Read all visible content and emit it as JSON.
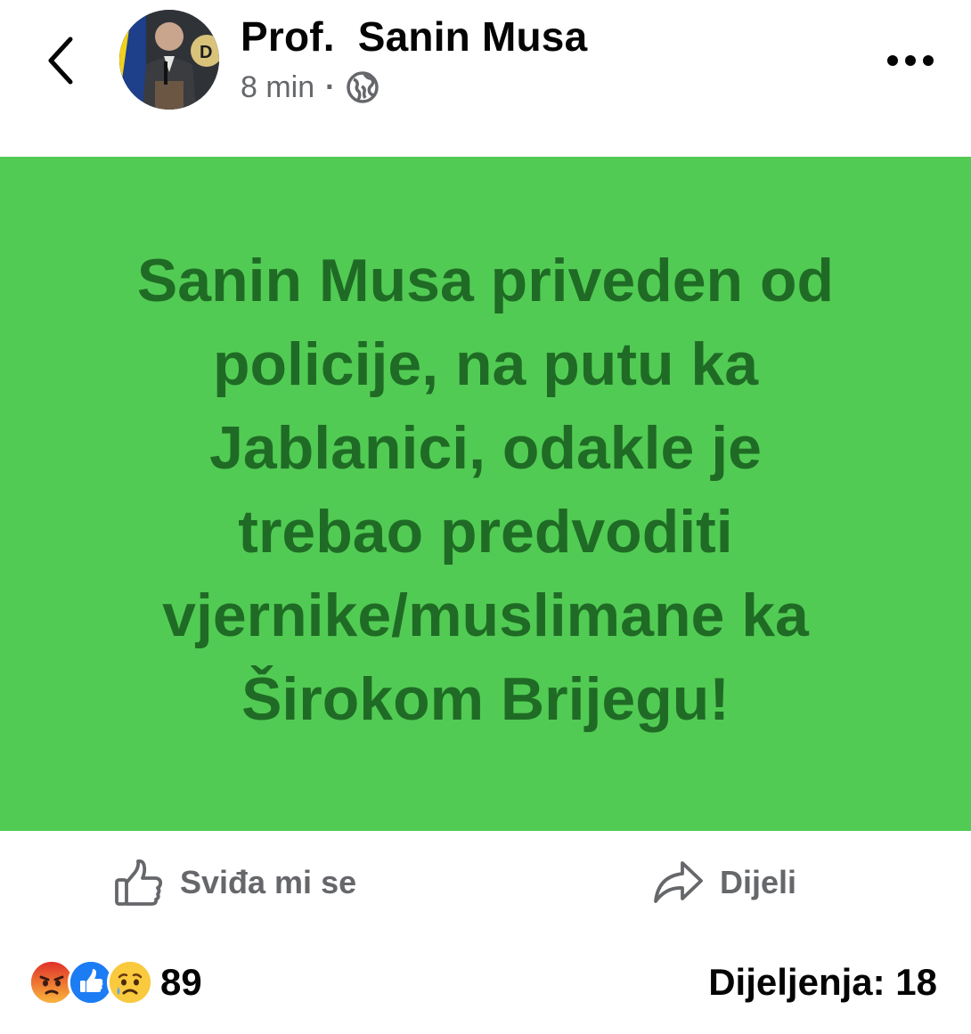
{
  "header": {
    "author_name": "Prof.  Sanin Musa",
    "time": "8 min",
    "separator": "·",
    "audience_icon": "globe-icon",
    "back_icon": "chevron-left-icon",
    "more_icon": "more-horizontal-icon"
  },
  "post": {
    "background_color": "#52cb54",
    "text_color": "#1f6b25",
    "text_lines": [
      "Sanin Musa priveden od",
      "policije, na putu ka",
      "Jablanici, odakle je",
      "trebao predvoditi",
      "vjernike/muslimane ka",
      "Širokom Brijegu!"
    ]
  },
  "actions": {
    "like_label": "Sviđa mi se",
    "like_icon": "thumbs-up-icon",
    "share_label": "Dijeli",
    "share_icon": "share-arrow-icon"
  },
  "footer": {
    "reaction_icons": [
      "angry-reaction-icon",
      "like-reaction-icon",
      "sad-reaction-icon"
    ],
    "reaction_count": "89",
    "shares_text": "Dijeljenja: 18"
  }
}
